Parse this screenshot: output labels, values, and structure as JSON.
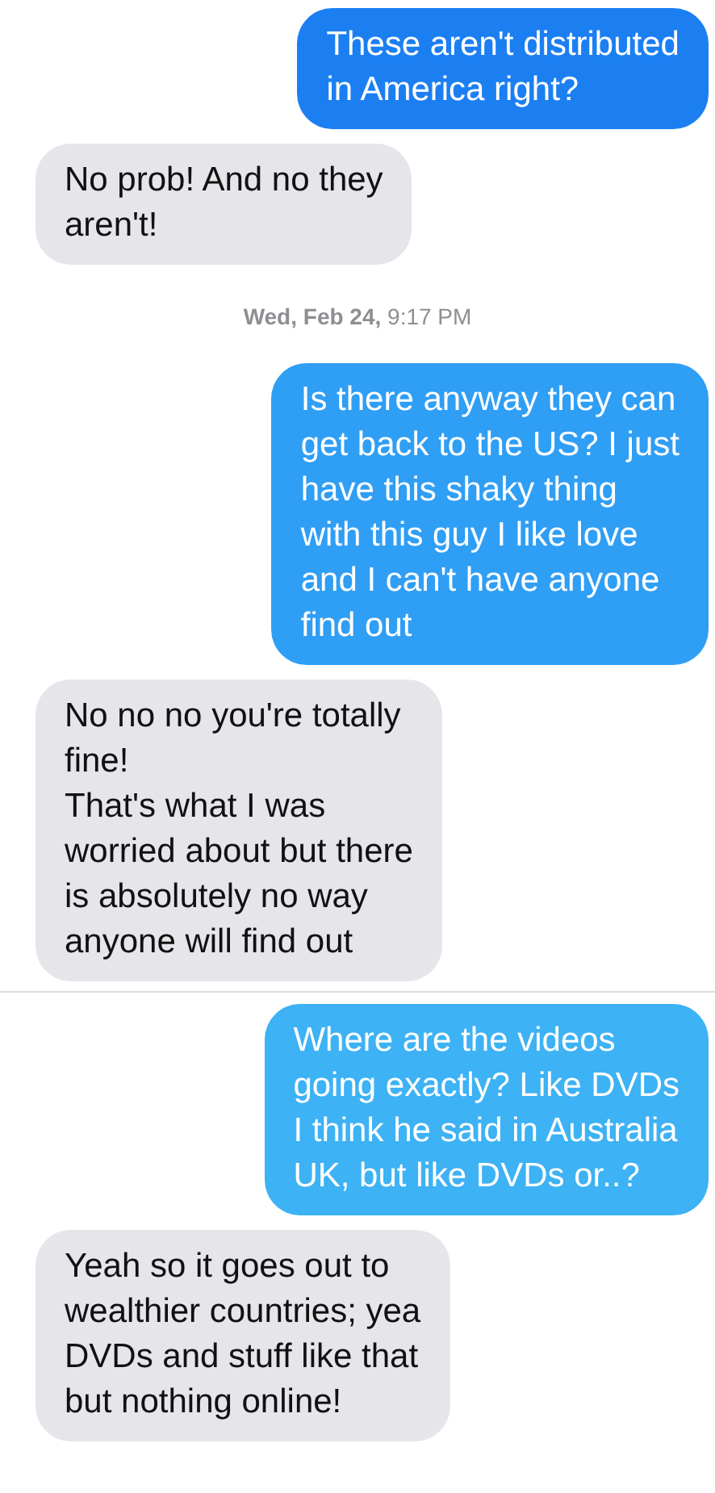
{
  "messages": [
    {
      "kind": "sent",
      "text": "These aren't distributed\nin America right?",
      "color": "#1b7ff2"
    },
    {
      "kind": "received",
      "text": "No prob! And no they\naren't!"
    },
    {
      "kind": "timestamp",
      "text": "**Wed, Feb 24,** 9:17 PM"
    },
    {
      "kind": "sent",
      "text": "Is there anyway they can\nget back to the US? I just\nhave this shaky thing\nwith this guy I like love\nand I can't have anyone\nfind out",
      "color": "#2f9ef5"
    },
    {
      "kind": "received",
      "text": "No no no you're totally\nfine!\nThat's what I was\nworried about but there\nis absolutely no way\nanyone will find out"
    },
    {
      "kind": "sent",
      "text": "Where are the videos\ngoing exactly? Like DVDs\nI think he said in Australia\nUK, but like DVDs or..?",
      "color": "#3db2f4"
    },
    {
      "kind": "received",
      "text": "Yeah so it goes out to\nwealthier countries; yea\nDVDs and stuff like that\nbut nothing online!"
    }
  ]
}
